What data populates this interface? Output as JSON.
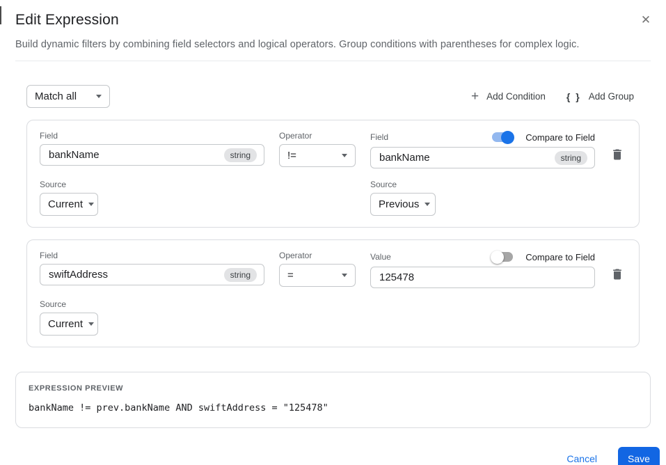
{
  "dialog": {
    "title": "Edit Expression",
    "subtitle": "Build dynamic filters by combining field selectors and logical operators. Group conditions with parentheses for complex logic.",
    "close_glyph": "✕"
  },
  "toolbar": {
    "match_select_value": "Match all",
    "add_condition_label": "Add Condition",
    "add_group_label": "Add Group",
    "plus_glyph": "+",
    "braces_glyph": "{ }"
  },
  "conditions": [
    {
      "field_label": "Field",
      "field_value": "bankName",
      "field_type": "string",
      "operator_label": "Operator",
      "operator_value": "!=",
      "compare_label": "Compare to Field",
      "compare_enabled": true,
      "right_label": "Field",
      "right_value": "bankName",
      "right_type": "string",
      "source_label": "Source",
      "source_value": "Current",
      "right_source_label": "Source",
      "right_source_value": "Previous"
    },
    {
      "field_label": "Field",
      "field_value": "swiftAddress",
      "field_type": "string",
      "operator_label": "Operator",
      "operator_value": "=",
      "compare_label": "Compare to Field",
      "compare_enabled": false,
      "right_label": "Value",
      "right_value": "125478",
      "source_label": "Source",
      "source_value": "Current"
    }
  ],
  "preview": {
    "label": "EXPRESSION PREVIEW",
    "expression": "bankName != prev.bankName AND swiftAddress = \"125478\""
  },
  "footer": {
    "cancel_label": "Cancel",
    "save_label": "Save"
  },
  "colors": {
    "accent_blue": "#1a73e8",
    "save_button_blue": "#1266e3",
    "toggle_on_track": "#93b8ef",
    "toggle_off_track": "#a6a6a6",
    "badge_background": "#e2e3e5",
    "card_border": "#dadce0",
    "text_primary": "#202124",
    "text_secondary": "#5f6368"
  }
}
